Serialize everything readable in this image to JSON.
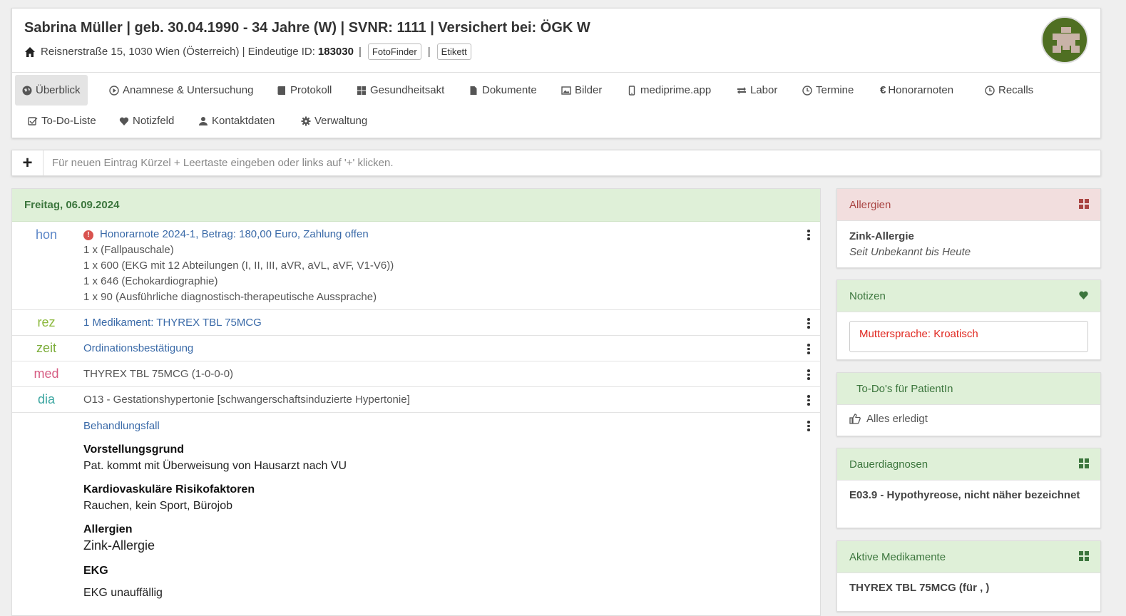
{
  "patient": {
    "title": "Sabrina Müller | geb. 30.04.1990 - 34 Jahre (W) | SVNR: 1111 | Versichert bei: ÖGK W",
    "address": "Reisnerstraße 15, 1030 Wien (Österreich) | Eindeutige ID: ",
    "id": "183030",
    "fotofinder": "FotoFinder",
    "etikett": "Etikett"
  },
  "tabs": [
    {
      "label": "Überblick",
      "icon": "globe-icon"
    },
    {
      "label": "Anamnese & Untersuchung",
      "icon": "play-circle-icon"
    },
    {
      "label": "Protokoll",
      "icon": "book-icon"
    },
    {
      "label": "Gesundheitsakt",
      "icon": "grid-icon"
    },
    {
      "label": "Dokumente",
      "icon": "file-icon"
    },
    {
      "label": "Bilder",
      "icon": "image-icon"
    },
    {
      "label": "mediprime.app",
      "icon": "phone-icon"
    },
    {
      "label": "Labor",
      "icon": "swap-icon"
    },
    {
      "label": "Termine",
      "icon": "clock-icon"
    },
    {
      "label": "Honorarnoten",
      "icon": "euro-icon"
    },
    {
      "label": "Recalls",
      "icon": "clock-icon"
    },
    {
      "label": "To-Do-Liste",
      "icon": "checkbox-icon"
    },
    {
      "label": "Notizfeld",
      "icon": "heart-icon"
    },
    {
      "label": "Kontaktdaten",
      "icon": "user-icon"
    },
    {
      "label": "Verwaltung",
      "icon": "gear-icon"
    }
  ],
  "entry": {
    "add_label": "+",
    "placeholder": "Für neuen Eintrag Kürzel + Leertaste eingeben oder links auf '+' klicken."
  },
  "journal": {
    "date": "Freitag, 06.09.2024",
    "hon": {
      "kind": "hon",
      "title": "Honorarnote 2024-1, Betrag: 180,00 Euro, Zahlung offen",
      "lines": [
        "1 x (Fallpauschale)",
        "1 x 600 (EKG mit 12 Abteilungen (I, II, III, aVR, aVL, aVF, V1-V6))",
        "1 x 646 (Echokardiographie)",
        "1 x 90 (Ausführliche diagnostisch-therapeutische Aussprache)"
      ]
    },
    "rez": {
      "kind": "rez",
      "text": "1 Medikament: THYREX TBL 75MCG"
    },
    "zeit": {
      "kind": "zeit",
      "text": "Ordinationsbestätigung"
    },
    "med": {
      "kind": "med",
      "text": "THYREX TBL 75MCG (1-0-0-0)"
    },
    "dia": {
      "kind": "dia",
      "text": "O13 - Gestationshypertonie [schwangerschaftsinduzierte Hypertonie]"
    },
    "fall": {
      "title": "Behandlungsfall",
      "h1": "Vorstellungsgrund",
      "t1": "Pat. kommt mit Überweisung von Hausarzt nach VU",
      "h2": "Kardiovaskuläre Risikofaktoren",
      "t2": "Rauchen, kein Sport, Bürojob",
      "h3": "Allergien",
      "t3": "Zink-Allergie",
      "h4": "EKG",
      "t4": "EKG unauffällig"
    }
  },
  "sidebar": {
    "allergien": {
      "title": "Allergien",
      "name": "Zink-Allergie",
      "since": "Seit Unbekannt bis Heute"
    },
    "notizen": {
      "title": "Notizen",
      "note": "Muttersprache: Kroatisch"
    },
    "todos": {
      "title": "To-Do's für PatientIn",
      "status": "Alles erledigt"
    },
    "dauer": {
      "title": "Dauerdiagnosen",
      "text": "E03.9 - Hypothyreose, nicht näher bezeichnet"
    },
    "medik": {
      "title": "Aktive Medikamente",
      "text": "THYREX TBL 75MCG (für , )"
    }
  },
  "colors": {
    "accent_green": "#dff0d8",
    "accent_red": "#f2dede",
    "link": "#3a6aa8",
    "alert": "#d9534f"
  }
}
